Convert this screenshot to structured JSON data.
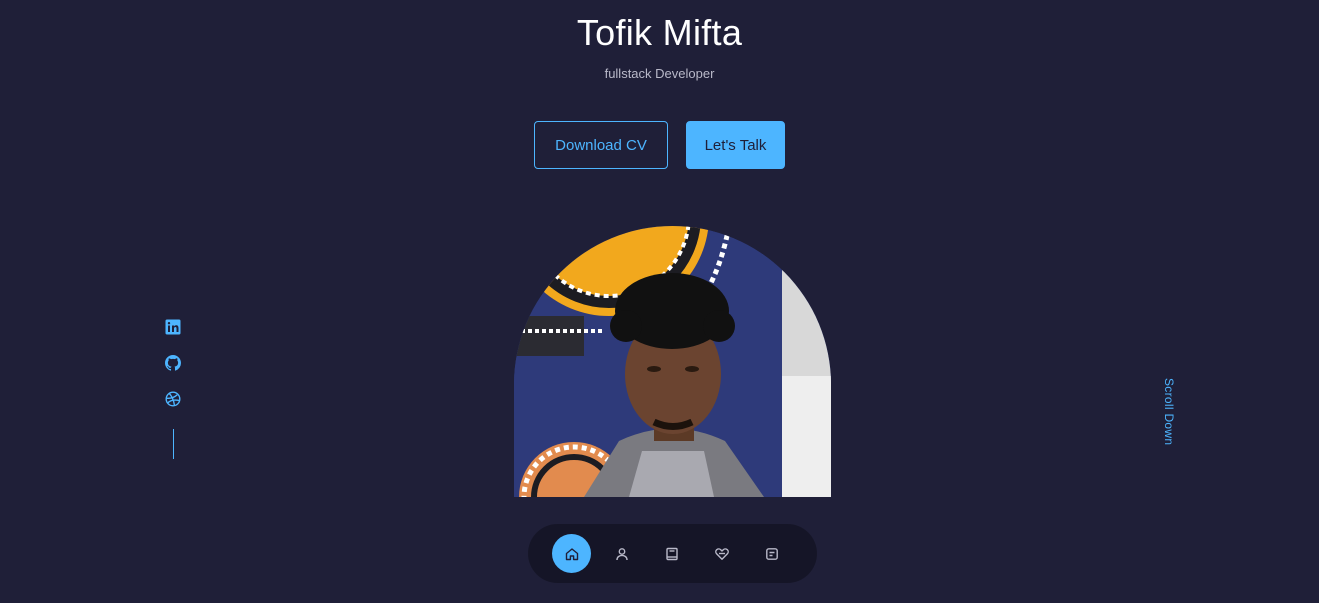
{
  "header": {
    "name": "Tofik Mifta",
    "role": "fullstack Developer"
  },
  "cta": {
    "download_label": "Download CV",
    "talk_label": "Let's Talk"
  },
  "socials": [
    {
      "icon": "linkedin-icon"
    },
    {
      "icon": "github-icon"
    },
    {
      "icon": "dribbble-icon"
    }
  ],
  "scroll_label": "Scroll Down",
  "nav": {
    "items": [
      {
        "icon": "home-icon",
        "active": true
      },
      {
        "icon": "user-icon",
        "active": false
      },
      {
        "icon": "book-icon",
        "active": false
      },
      {
        "icon": "services-icon",
        "active": false
      },
      {
        "icon": "message-icon",
        "active": false
      }
    ]
  },
  "colors": {
    "background": "#1f1f38",
    "accent": "#4db5ff",
    "text": "#ffffff",
    "muted": "#b9b9c9"
  }
}
